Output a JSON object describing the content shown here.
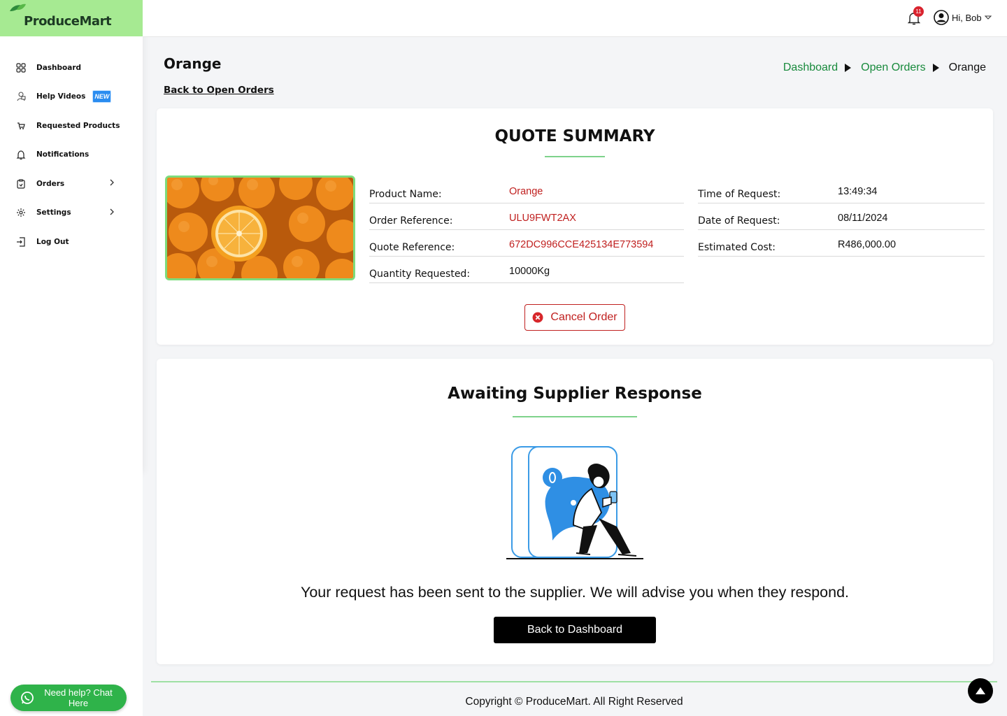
{
  "brand": {
    "name": "ProduceMart",
    "accent": "#a6ea92"
  },
  "sidebar": {
    "items": [
      {
        "label": "Dashboard",
        "icon": "grid-icon"
      },
      {
        "label": "Help Videos",
        "icon": "video-icon",
        "badge": "NEW"
      },
      {
        "label": "Requested Products",
        "icon": "cart-icon"
      },
      {
        "label": "Notifications",
        "icon": "bell-icon"
      },
      {
        "label": "Orders",
        "icon": "clipboard-icon",
        "has_submenu": true
      },
      {
        "label": "Settings",
        "icon": "gear-icon",
        "has_submenu": true
      },
      {
        "label": "Log Out",
        "icon": "logout-icon"
      }
    ]
  },
  "chat": {
    "label": "Need help? Chat Here",
    "icon": "whatsapp-icon"
  },
  "topbar": {
    "notification_count": "11",
    "greeting": "Hi, Bob"
  },
  "page": {
    "title": "Orange",
    "back_link": "Back to Open Orders",
    "breadcrumb": {
      "first": "Dashboard",
      "second": "Open Orders",
      "current": "Orange"
    }
  },
  "quote": {
    "title": "QUOTE SUMMARY",
    "left": [
      {
        "key": "Product Name:",
        "value": "Orange"
      },
      {
        "key": "Order Reference:",
        "value": "ULU9FWT2AX"
      },
      {
        "key": "Quote Reference:",
        "value": "672DC996CCE425134E773594"
      },
      {
        "key": "Quantity Requested:",
        "value": "10000Kg"
      }
    ],
    "right": [
      {
        "key": "Time of Request:",
        "value": "13:49:34"
      },
      {
        "key": "Date of Request:",
        "value": "08/11/2024"
      },
      {
        "key": "Estimated Cost:",
        "value": "R486,000.00"
      }
    ],
    "cancel_label": "Cancel Order"
  },
  "awaiting": {
    "title": "Awaiting Supplier Response",
    "message": "Your request has been sent to the supplier. We will advise you when they respond.",
    "button_label": "Back to Dashboard"
  },
  "footer": {
    "copyright": "Copyright © ProduceMart. All Right Reserved"
  }
}
